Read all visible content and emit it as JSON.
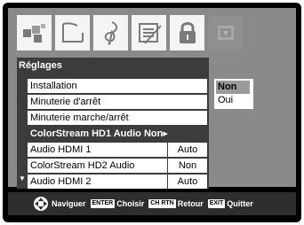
{
  "tabs": [
    {
      "icon": "picture-icon"
    },
    {
      "icon": "screen-icon"
    },
    {
      "icon": "music-note-icon"
    },
    {
      "icon": "settings-sliders-icon"
    },
    {
      "icon": "lock-icon"
    },
    {
      "icon": "setup-icon"
    }
  ],
  "menu": {
    "title": "Réglages",
    "items": [
      {
        "label": "Installation",
        "value": ""
      },
      {
        "label": "Minuterie d'arrêt",
        "value": ""
      },
      {
        "label": "Minuterie marche/arrêt",
        "value": ""
      },
      {
        "label": "ColorStream HD1 Audio Non▸",
        "value": ""
      },
      {
        "label": "Audio HDMI 1",
        "value": "Auto"
      },
      {
        "label": "ColorStream HD2 Audio",
        "value": "Non"
      },
      {
        "label": "Audio HDMI 2",
        "value": "Auto"
      }
    ],
    "scroll_arrow": "▼"
  },
  "options": [
    "Non",
    "Oui"
  ],
  "footer": {
    "navigate_label": "Naviguer",
    "enter_key": "ENTER",
    "choose_label": "Choisir",
    "return_key": "CH RTN",
    "return_label": "Retour",
    "exit_key": "EXIT",
    "exit_label": "Quitter"
  }
}
